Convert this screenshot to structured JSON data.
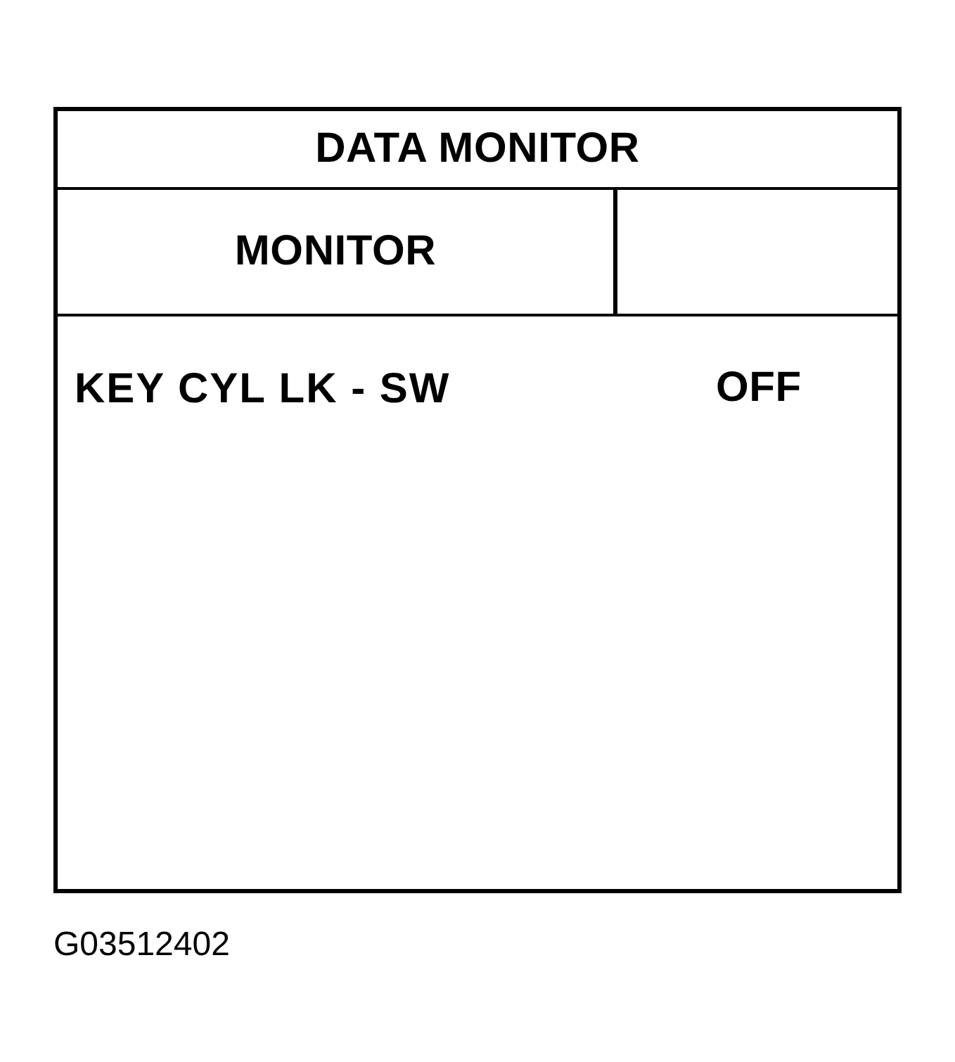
{
  "panel": {
    "title": "DATA MONITOR",
    "column_label": "MONITOR",
    "rows": [
      {
        "item": "KEY CYL LK - SW",
        "value": "OFF"
      }
    ]
  },
  "figure_code": "G03512402"
}
